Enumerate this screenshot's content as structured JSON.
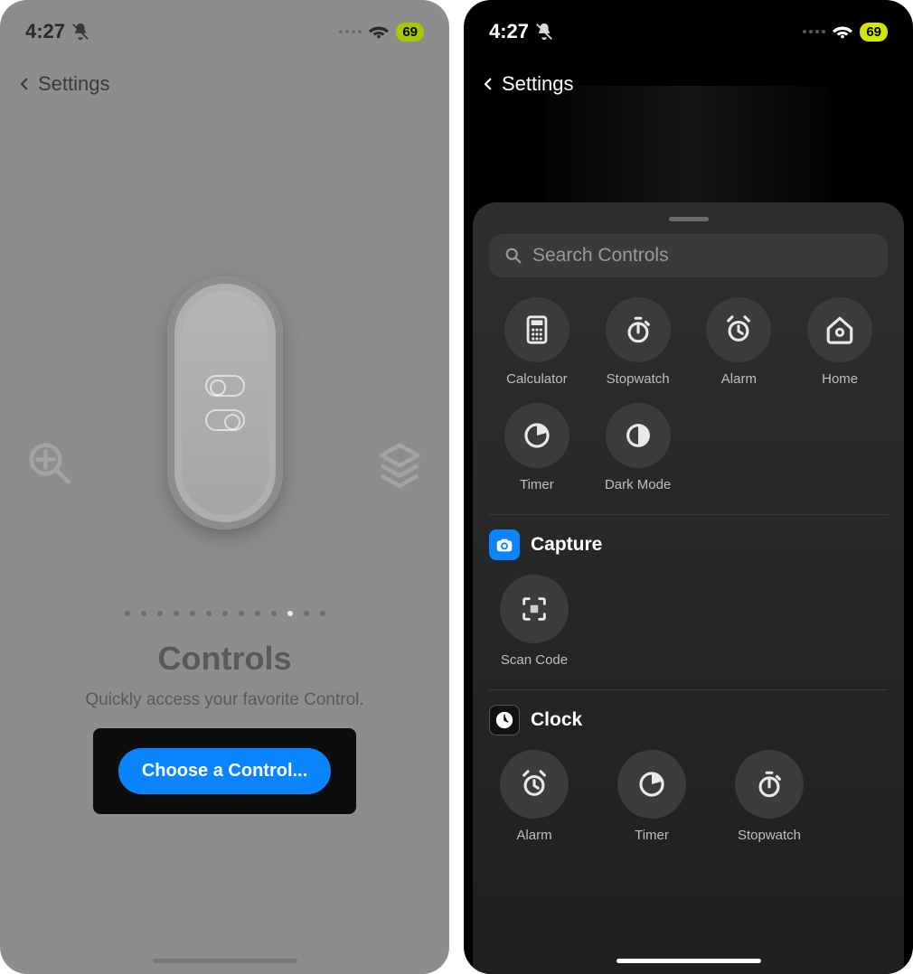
{
  "status": {
    "time": "4:27",
    "battery": "69"
  },
  "nav": {
    "back": "Settings"
  },
  "left": {
    "title": "Controls",
    "subtitle": "Quickly access your favorite Control.",
    "button": "Choose a Control...",
    "page_dots": {
      "count": 13,
      "active_index": 10
    }
  },
  "right": {
    "search_placeholder": "Search Controls",
    "top_controls": [
      {
        "name": "Calculator",
        "icon": "calculator"
      },
      {
        "name": "Stopwatch",
        "icon": "stopwatch"
      },
      {
        "name": "Alarm",
        "icon": "alarm"
      },
      {
        "name": "Home",
        "icon": "home"
      },
      {
        "name": "Timer",
        "icon": "timer"
      },
      {
        "name": "Dark Mode",
        "icon": "darkmode"
      }
    ],
    "sections": [
      {
        "title": "Capture",
        "icon": "camera",
        "items": [
          {
            "name": "Scan Code",
            "icon": "qr"
          }
        ]
      },
      {
        "title": "Clock",
        "icon": "clockface",
        "items": [
          {
            "name": "Alarm",
            "icon": "alarm"
          },
          {
            "name": "Timer",
            "icon": "timer"
          },
          {
            "name": "Stopwatch",
            "icon": "stopwatch"
          }
        ]
      }
    ]
  }
}
